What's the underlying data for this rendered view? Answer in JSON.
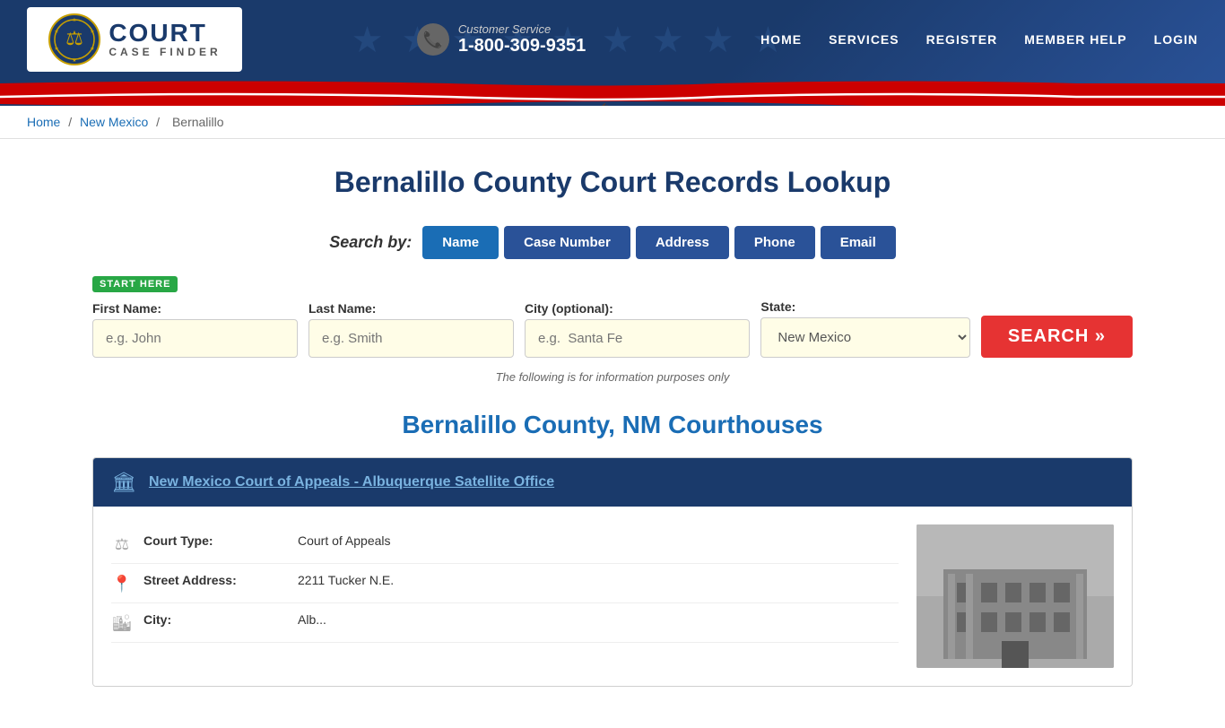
{
  "header": {
    "logo": {
      "court_text": "COURT",
      "case_finder_text": "CASE FINDER"
    },
    "customer_service": {
      "label": "Customer Service",
      "phone": "1-800-309-9351"
    },
    "nav": {
      "items": [
        {
          "id": "home",
          "label": "HOME"
        },
        {
          "id": "services",
          "label": "SERVICES"
        },
        {
          "id": "register",
          "label": "REGISTER"
        },
        {
          "id": "member-help",
          "label": "MEMBER HELP"
        },
        {
          "id": "login",
          "label": "LOGIN"
        }
      ]
    }
  },
  "breadcrumb": {
    "home": "Home",
    "state": "New Mexico",
    "county": "Bernalillo"
  },
  "main": {
    "page_title": "Bernalillo County Court Records Lookup",
    "search_by_label": "Search by:",
    "search_tabs": [
      {
        "id": "name",
        "label": "Name",
        "active": true
      },
      {
        "id": "case-number",
        "label": "Case Number",
        "active": false
      },
      {
        "id": "address",
        "label": "Address",
        "active": false
      },
      {
        "id": "phone",
        "label": "Phone",
        "active": false
      },
      {
        "id": "email",
        "label": "Email",
        "active": false
      }
    ],
    "start_here_badge": "START HERE",
    "form": {
      "first_name_label": "First Name:",
      "first_name_placeholder": "e.g. John",
      "last_name_label": "Last Name:",
      "last_name_placeholder": "e.g. Smith",
      "city_label": "City (optional):",
      "city_placeholder": "e.g.  Santa Fe",
      "state_label": "State:",
      "state_value": "New Mexico",
      "search_button": "SEARCH »"
    },
    "info_note": "The following is for information purposes only",
    "courthouses_title": "Bernalillo County, NM Courthouses",
    "courthouse": {
      "name": "New Mexico Court of Appeals - Albuquerque Satellite Office",
      "court_type_label": "Court Type:",
      "court_type_value": "Court of Appeals",
      "street_label": "Street Address:",
      "street_value": "2211 Tucker N.E.",
      "city_label": "City:",
      "city_value": "Alb..."
    }
  }
}
